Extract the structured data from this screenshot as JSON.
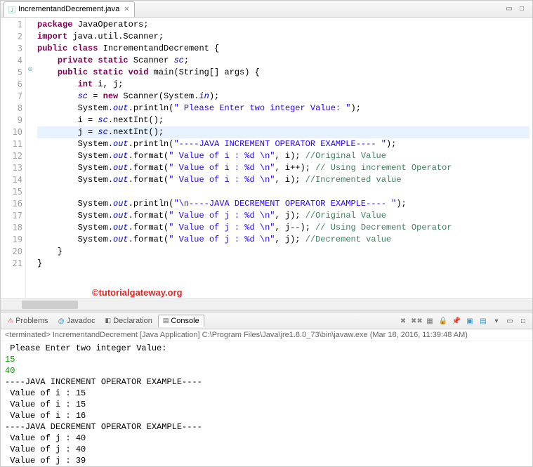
{
  "tab": {
    "filename": "IncrementandDecrement.java"
  },
  "watermark": "©tutorialgateway.org",
  "code": {
    "lines": [
      {
        "n": 1,
        "tokens": [
          [
            "kw",
            "package"
          ],
          [
            "",
            " JavaOperators;"
          ]
        ]
      },
      {
        "n": 2,
        "tokens": [
          [
            "kw",
            "import"
          ],
          [
            "",
            " java.util.Scanner;"
          ]
        ]
      },
      {
        "n": 3,
        "tokens": [
          [
            "kw",
            "public class"
          ],
          [
            "",
            " IncrementandDecrement {"
          ]
        ]
      },
      {
        "n": 4,
        "tokens": [
          [
            "",
            "    "
          ],
          [
            "kw",
            "private static"
          ],
          [
            "",
            " Scanner "
          ],
          [
            "sfld",
            "sc"
          ],
          [
            "",
            ";"
          ]
        ]
      },
      {
        "n": 5,
        "marker": "⊖",
        "tokens": [
          [
            "",
            "    "
          ],
          [
            "kw",
            "public static void"
          ],
          [
            "",
            " main(String[] args) {"
          ]
        ]
      },
      {
        "n": 6,
        "tokens": [
          [
            "",
            "        "
          ],
          [
            "kw",
            "int"
          ],
          [
            "",
            " i, j;"
          ]
        ]
      },
      {
        "n": 7,
        "tokens": [
          [
            "",
            "        "
          ],
          [
            "sfld",
            "sc"
          ],
          [
            "",
            " = "
          ],
          [
            "kw",
            "new"
          ],
          [
            "",
            " Scanner(System."
          ],
          [
            "sfld",
            "in"
          ],
          [
            "",
            ");"
          ]
        ]
      },
      {
        "n": 8,
        "tokens": [
          [
            "",
            "        System."
          ],
          [
            "sfld",
            "out"
          ],
          [
            "",
            ".println("
          ],
          [
            "str",
            "\" Please Enter two integer Value: \""
          ],
          [
            "",
            ");"
          ]
        ]
      },
      {
        "n": 9,
        "tokens": [
          [
            "",
            "        i = "
          ],
          [
            "sfld",
            "sc"
          ],
          [
            "",
            ".nextInt();"
          ]
        ]
      },
      {
        "n": 10,
        "hl": true,
        "tokens": [
          [
            "",
            "        j = "
          ],
          [
            "sfld",
            "sc"
          ],
          [
            "",
            ".nextInt();"
          ]
        ]
      },
      {
        "n": 11,
        "tokens": [
          [
            "",
            "        System."
          ],
          [
            "sfld",
            "out"
          ],
          [
            "",
            ".println("
          ],
          [
            "str",
            "\"----JAVA INCREMENT OPERATOR EXAMPLE---- \""
          ],
          [
            "",
            ");"
          ]
        ]
      },
      {
        "n": 12,
        "tokens": [
          [
            "",
            "        System."
          ],
          [
            "sfld",
            "out"
          ],
          [
            "",
            ".format("
          ],
          [
            "str",
            "\" Value of i : %d \\n\""
          ],
          [
            "",
            ", i); "
          ],
          [
            "com",
            "//Original Value"
          ]
        ]
      },
      {
        "n": 13,
        "tokens": [
          [
            "",
            "        System."
          ],
          [
            "sfld",
            "out"
          ],
          [
            "",
            ".format("
          ],
          [
            "str",
            "\" Value of i : %d \\n\""
          ],
          [
            "",
            ", i++); "
          ],
          [
            "com",
            "// Using increment Operator"
          ]
        ]
      },
      {
        "n": 14,
        "tokens": [
          [
            "",
            "        System."
          ],
          [
            "sfld",
            "out"
          ],
          [
            "",
            ".format("
          ],
          [
            "str",
            "\" Value of i : %d \\n\""
          ],
          [
            "",
            ", i); "
          ],
          [
            "com",
            "//Incremented value"
          ]
        ]
      },
      {
        "n": 15,
        "tokens": [
          [
            "",
            ""
          ]
        ]
      },
      {
        "n": 16,
        "tokens": [
          [
            "",
            "        System."
          ],
          [
            "sfld",
            "out"
          ],
          [
            "",
            ".println("
          ],
          [
            "str",
            "\"\\n----JAVA DECREMENT OPERATOR EXAMPLE---- \""
          ],
          [
            "",
            ");"
          ]
        ]
      },
      {
        "n": 17,
        "tokens": [
          [
            "",
            "        System."
          ],
          [
            "sfld",
            "out"
          ],
          [
            "",
            ".format("
          ],
          [
            "str",
            "\" Value of j : %d \\n\""
          ],
          [
            "",
            ", j); "
          ],
          [
            "com",
            "//Original Value"
          ]
        ]
      },
      {
        "n": 18,
        "tokens": [
          [
            "",
            "        System."
          ],
          [
            "sfld",
            "out"
          ],
          [
            "",
            ".format("
          ],
          [
            "str",
            "\" Value of j : %d \\n\""
          ],
          [
            "",
            ", j--); "
          ],
          [
            "com",
            "// Using Decrement Operator"
          ]
        ]
      },
      {
        "n": 19,
        "tokens": [
          [
            "",
            "        System."
          ],
          [
            "sfld",
            "out"
          ],
          [
            "",
            ".format("
          ],
          [
            "str",
            "\" Value of j : %d \\n\""
          ],
          [
            "",
            ", j); "
          ],
          [
            "com",
            "//Decrement value"
          ]
        ]
      },
      {
        "n": 20,
        "tokens": [
          [
            "",
            "    }"
          ]
        ]
      },
      {
        "n": 21,
        "tokens": [
          [
            "",
            "}"
          ]
        ]
      }
    ]
  },
  "panel": {
    "tabs": {
      "problems": "Problems",
      "javadoc": "Javadoc",
      "declaration": "Declaration",
      "console": "Console"
    }
  },
  "console": {
    "status": "<terminated> IncrementandDecrement [Java Application] C:\\Program Files\\Java\\jre1.8.0_73\\bin\\javaw.exe (Mar 18, 2016, 11:39:48 AM)",
    "output": [
      {
        "t": " Please Enter two integer Value: "
      },
      {
        "t": "15",
        "cls": "input-line"
      },
      {
        "t": "40",
        "cls": "input-line"
      },
      {
        "t": "----JAVA INCREMENT OPERATOR EXAMPLE---- "
      },
      {
        "t": " Value of i : 15 "
      },
      {
        "t": " Value of i : 15 "
      },
      {
        "t": " Value of i : 16 "
      },
      {
        "t": ""
      },
      {
        "t": "----JAVA DECREMENT OPERATOR EXAMPLE---- "
      },
      {
        "t": " Value of j : 40 "
      },
      {
        "t": " Value of j : 40 "
      },
      {
        "t": " Value of j : 39 "
      }
    ]
  }
}
